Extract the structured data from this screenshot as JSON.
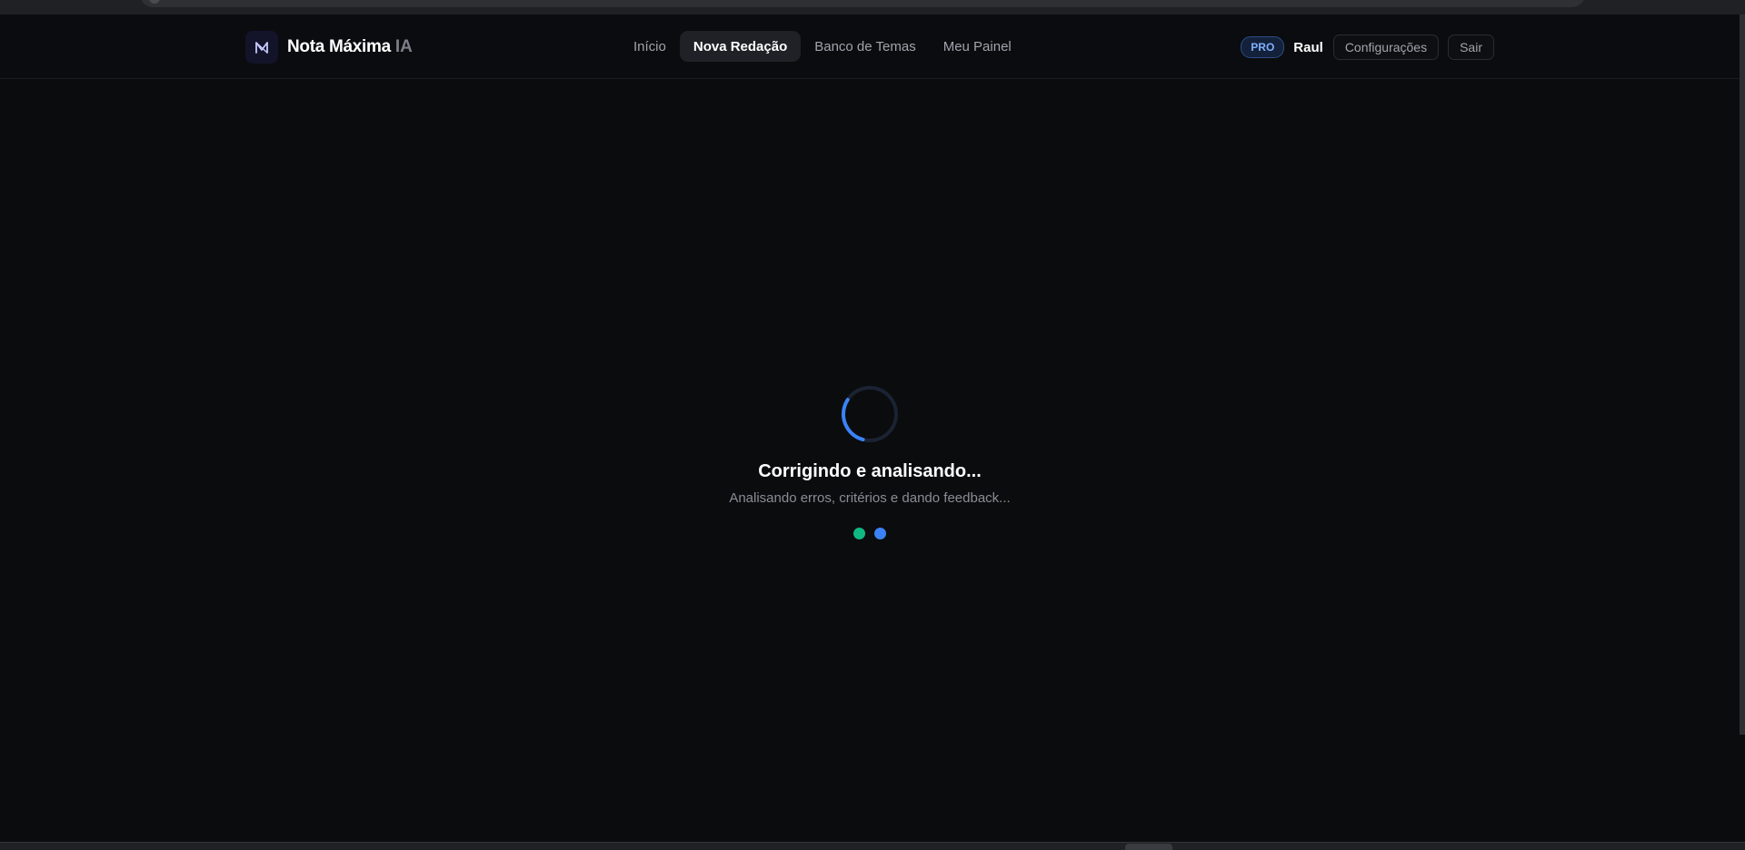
{
  "brand": {
    "name": "Nota Máxima",
    "suffix": "IA",
    "logo_icon": "m-logo-icon"
  },
  "nav": {
    "items": [
      {
        "label": "Início",
        "active": false
      },
      {
        "label": "Nova Redação",
        "active": true
      },
      {
        "label": "Banco de Temas",
        "active": false
      },
      {
        "label": "Meu Painel",
        "active": false
      }
    ]
  },
  "user": {
    "plan_badge": "PRO",
    "name": "Raul",
    "settings_label": "Configurações",
    "logout_label": "Sair"
  },
  "loading": {
    "title": "Corrigindo e analisando...",
    "subtitle": "Analisando erros, critérios e dando feedback...",
    "spinner_progress": 0.3,
    "dots": [
      {
        "color": "#10b981"
      },
      {
        "color": "#3b82f6"
      }
    ]
  },
  "colors": {
    "accent": "#3b82f6",
    "success": "#10b981",
    "background": "#0b0c0e"
  }
}
